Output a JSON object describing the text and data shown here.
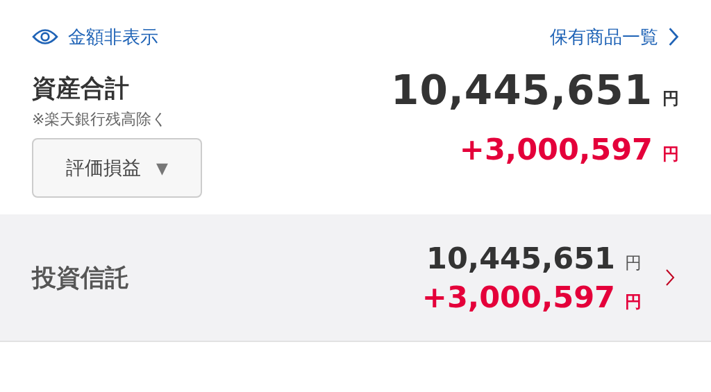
{
  "header": {
    "hide_amounts": {
      "label": "金額非表示"
    },
    "holdings_link": {
      "label": "保有商品一覧"
    }
  },
  "summary": {
    "title": "資産合計",
    "note": "※楽天銀行残高除く",
    "dropdown": {
      "label": "評価損益",
      "caret": "▼"
    },
    "total": {
      "value": "10,445,651",
      "unit": "円"
    },
    "gain": {
      "value": "+3,000,597",
      "unit": "円"
    }
  },
  "categories": [
    {
      "name": "投資信託",
      "total": {
        "value": "10,445,651",
        "unit": "円"
      },
      "gain": {
        "value": "+3,000,597",
        "unit": "円"
      }
    }
  ]
}
